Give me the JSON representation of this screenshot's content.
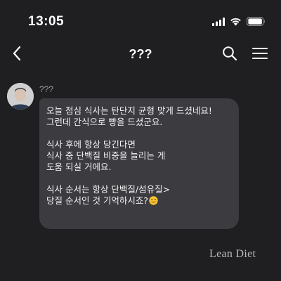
{
  "status_bar": {
    "time": "13:05",
    "icons": [
      "cellular-signal-icon",
      "wifi-icon",
      "battery-icon"
    ]
  },
  "nav": {
    "title": "???",
    "icons": [
      "chevron-left-icon",
      "search-icon",
      "hamburger-menu-icon"
    ]
  },
  "message": {
    "sender": "???",
    "lines": [
      "오늘 점심 식사는 탄단지 균형 맞게 드셨네요!",
      "그런데 간식으로 빵을 드셨군요.",
      "",
      "식사 후에 항상 당긴다면",
      "식사 중 단백질 비중을 늘리는 게",
      "도움 되실 거에요.",
      "",
      "식사 순서는 항상 단백질/섬유질>",
      "당질 순서인 것 기억하시죠?"
    ],
    "trailing_emoji": "smiling-face-emoji"
  },
  "watermark": "Lean Diet",
  "colors": {
    "background": "#1f1f22",
    "bubble": "#3b3b40",
    "text": "#f2f2f2",
    "muted": "#9a9a9f"
  }
}
